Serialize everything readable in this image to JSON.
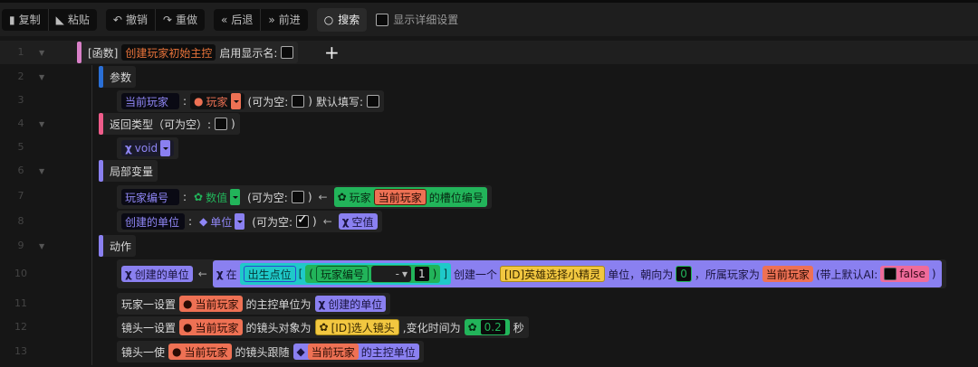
{
  "toolbar": {
    "copy": "复制",
    "paste": "粘贴",
    "undo": "撤销",
    "redo": "重做",
    "back": "后退",
    "forward": "前进",
    "search": "搜索",
    "show_details": "显示详细设置"
  },
  "lines": [
    "1",
    "2",
    "3",
    "4",
    "5",
    "6",
    "7",
    "8",
    "9",
    "10",
    "11",
    "12",
    "13"
  ],
  "row1": {
    "tag": "[函数]",
    "name": "创建玩家初始主控",
    "display_label": "启用显示名:",
    "add": "+"
  },
  "row2": {
    "label": "参数"
  },
  "row3": {
    "var": "当前玩家",
    "colon": ":",
    "type": "玩家",
    "nullable": "(可为空:",
    "close": ")",
    "default": "默认填写:"
  },
  "row4": {
    "label": "返回类型（可为空）:",
    "close": ")"
  },
  "row5": {
    "type": "void"
  },
  "row6": {
    "label": "局部变量"
  },
  "row7": {
    "var": "玩家编号",
    "colon": ":",
    "type": "数值",
    "nullable": "(可为空:",
    "close": ")",
    "arrow": "←",
    "p1": "玩家",
    "p2": "当前玩家",
    "p3": "的槽位编号"
  },
  "row8": {
    "var": "创建的单位",
    "colon": ":",
    "type": "单位",
    "nullable": "(可为空:",
    "close": ")",
    "arrow": "←",
    "value": "空值",
    "nullable_checked": true
  },
  "row9": {
    "label": "动作"
  },
  "row10": {
    "target": "创建的单位",
    "arrow": "←",
    "at": "在",
    "spawn": "出生点位",
    "lb": "[",
    "lp": "(",
    "idx": "玩家编号",
    "op": "-",
    "num": "1",
    "rp": ")",
    "rb": "]",
    "create": "创建一个",
    "unit": "[ID]英雄选择小精灵",
    "facing": "单位，朝向为",
    "angle": "0",
    "owner": "，所属玩家为",
    "player": "当前玩家",
    "ai": "(带上默认AI:",
    "bool": "false",
    "end": ")"
  },
  "row11": {
    "prefix": "玩家一设置",
    "player": "当前玩家",
    "mid": "的主控单位为",
    "value": "创建的单位"
  },
  "row12": {
    "prefix": "镜头一设置",
    "player": "当前玩家",
    "mid": "的镜头对象为",
    "cam": "[ID]选人镜头",
    "mid2": ",变化时间为",
    "time": "0.2",
    "unit": "秒"
  },
  "row13": {
    "prefix": "镜头一使",
    "player": "当前玩家",
    "mid": "的镜头跟随",
    "player2": "当前玩家",
    "suffix": "的主控单位"
  },
  "colors": {
    "purple": "#8a80f0",
    "orange": "#ee7154",
    "green": "#22b45a",
    "yellow": "#f2c740",
    "teal": "#1fc9c9",
    "pink": "#ef6b9a",
    "func_bar": "#d980c8",
    "param_bar": "#2a6fd6",
    "return_bar": "#ef5c8a"
  }
}
